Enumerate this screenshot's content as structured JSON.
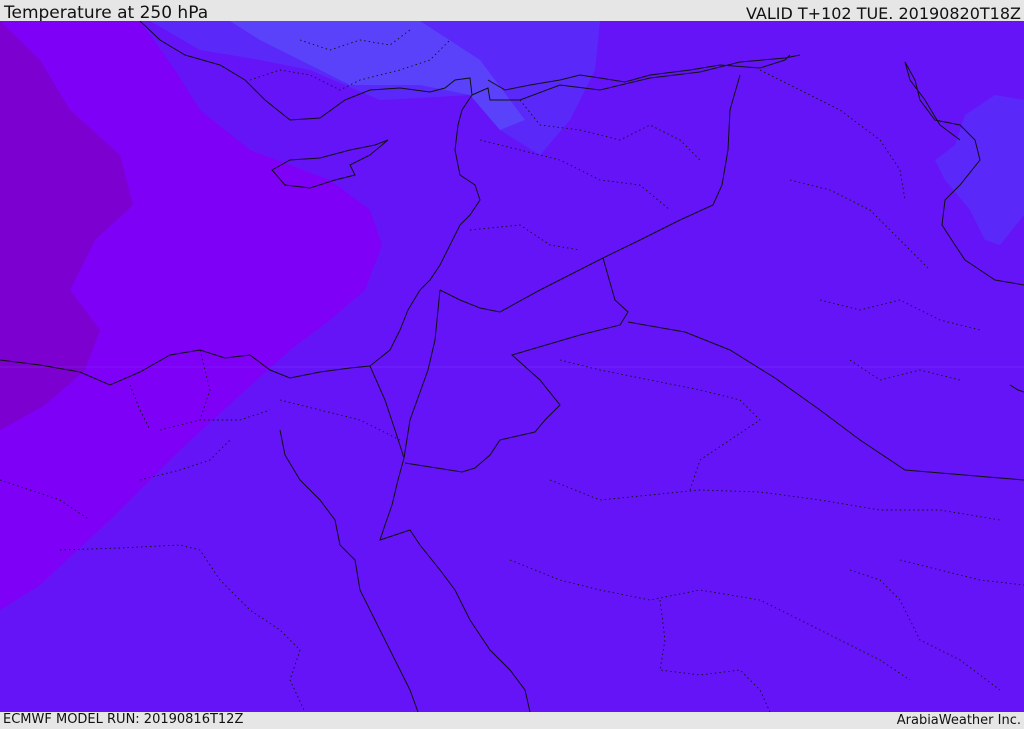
{
  "header": {
    "title": "Temperature at 250 hPa",
    "valid_time": "VALID T+102 TUE. 20190820T18Z"
  },
  "footer": {
    "model_run": "ECMWF MODEL RUN: 20190816T12Z",
    "credit": "ArabiaWeather Inc."
  },
  "map": {
    "variable": "temperature",
    "level": "250 hPa",
    "colors": {
      "warmest_band": "#7c00d0",
      "warm_band": "#7e00f6",
      "base_band": "#6514f8",
      "cool_band": "#5b28fa",
      "coolest_band": "#5a45fb",
      "boundary_line": "#111111"
    }
  }
}
